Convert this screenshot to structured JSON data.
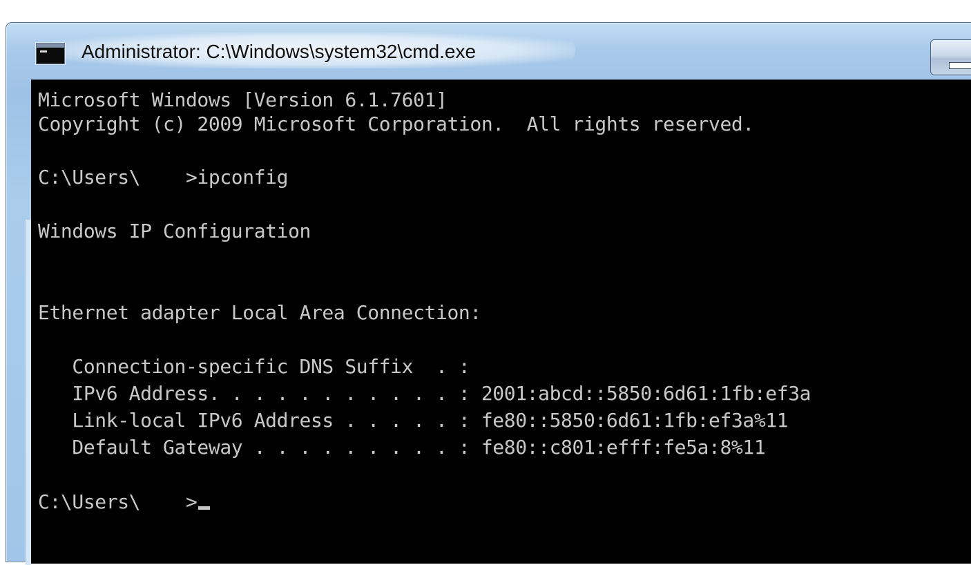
{
  "window": {
    "title": "Administrator: C:\\Windows\\system32\\cmd.exe",
    "icon": "cmd-icon",
    "controls": {
      "minimize": "minimize-icon"
    }
  },
  "colors": {
    "console_bg": "#000000",
    "console_text": "#c8c8c8",
    "frame": "#a8c9ea"
  },
  "console": {
    "lines": [
      "Microsoft Windows [Version 6.1.7601]",
      "Copyright (c) 2009 Microsoft Corporation.  All rights reserved.",
      "C:\\Users\\    >ipconfig",
      "Windows IP Configuration",
      "Ethernet adapter Local Area Connection:",
      "   Connection-specific DNS Suffix  . :",
      "   IPv6 Address. . . . . . . . . . . : 2001:abcd::5850:6d61:1fb:ef3a",
      "   Link-local IPv6 Address . . . . . : fe80::5850:6d61:1fb:ef3a%11",
      "   Default Gateway . . . . . . . . . : fe80::c801:efff:fe5a:8%11",
      "C:\\Users\\    >"
    ]
  }
}
